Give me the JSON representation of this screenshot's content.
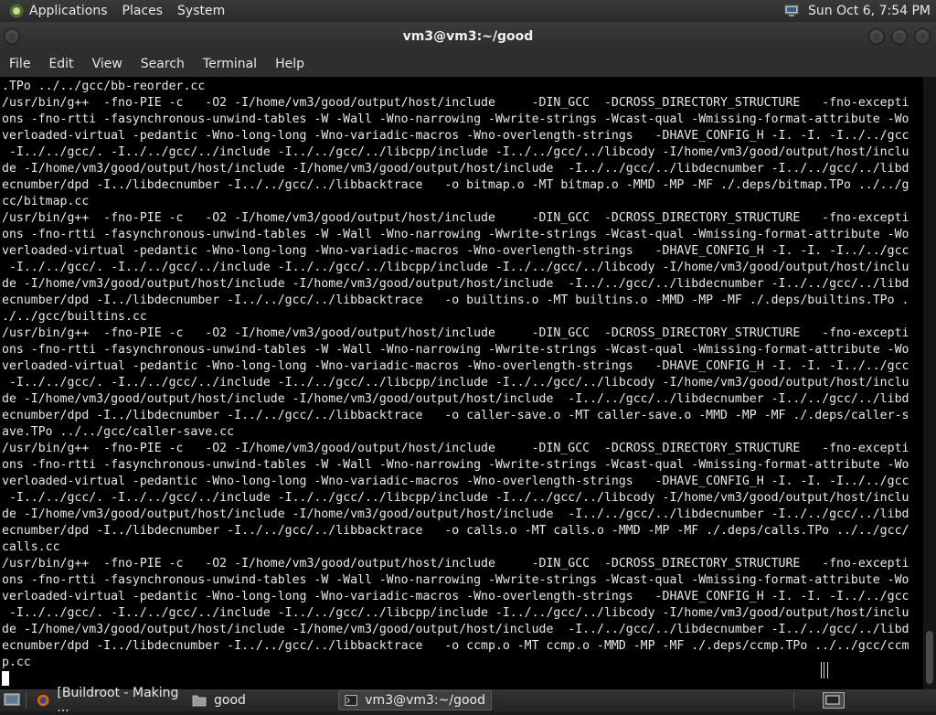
{
  "top_panel": {
    "menus": [
      "Applications",
      "Places",
      "System"
    ],
    "clock": "Sun Oct  6,  7:54 PM"
  },
  "window": {
    "title": "vm3@vm3:~/good",
    "menu": [
      "File",
      "Edit",
      "View",
      "Search",
      "Terminal",
      "Help"
    ]
  },
  "terminal": {
    "lines": [
      ".TPo ../../gcc/bb-reorder.cc",
      "/usr/bin/g++  -fno-PIE -c   -O2 -I/home/vm3/good/output/host/include     -DIN_GCC  -DCROSS_DIRECTORY_STRUCTURE   -fno-excepti",
      "ons -fno-rtti -fasynchronous-unwind-tables -W -Wall -Wno-narrowing -Wwrite-strings -Wcast-qual -Wmissing-format-attribute -Wo",
      "verloaded-virtual -pedantic -Wno-long-long -Wno-variadic-macros -Wno-overlength-strings   -DHAVE_CONFIG_H -I. -I. -I../../gcc",
      " -I../../gcc/. -I../../gcc/../include -I../../gcc/../libcpp/include -I../../gcc/../libcody -I/home/vm3/good/output/host/inclu",
      "de -I/home/vm3/good/output/host/include -I/home/vm3/good/output/host/include  -I../../gcc/../libdecnumber -I../../gcc/../libd",
      "ecnumber/dpd -I../libdecnumber -I../../gcc/../libbacktrace   -o bitmap.o -MT bitmap.o -MMD -MP -MF ./.deps/bitmap.TPo ../../g",
      "cc/bitmap.cc",
      "/usr/bin/g++  -fno-PIE -c   -O2 -I/home/vm3/good/output/host/include     -DIN_GCC  -DCROSS_DIRECTORY_STRUCTURE   -fno-excepti",
      "ons -fno-rtti -fasynchronous-unwind-tables -W -Wall -Wno-narrowing -Wwrite-strings -Wcast-qual -Wmissing-format-attribute -Wo",
      "verloaded-virtual -pedantic -Wno-long-long -Wno-variadic-macros -Wno-overlength-strings   -DHAVE_CONFIG_H -I. -I. -I../../gcc",
      " -I../../gcc/. -I../../gcc/../include -I../../gcc/../libcpp/include -I../../gcc/../libcody -I/home/vm3/good/output/host/inclu",
      "de -I/home/vm3/good/output/host/include -I/home/vm3/good/output/host/include  -I../../gcc/../libdecnumber -I../../gcc/../libd",
      "ecnumber/dpd -I../libdecnumber -I../../gcc/../libbacktrace   -o builtins.o -MT builtins.o -MMD -MP -MF ./.deps/builtins.TPo .",
      "./../gcc/builtins.cc",
      "/usr/bin/g++  -fno-PIE -c   -O2 -I/home/vm3/good/output/host/include     -DIN_GCC  -DCROSS_DIRECTORY_STRUCTURE   -fno-excepti",
      "ons -fno-rtti -fasynchronous-unwind-tables -W -Wall -Wno-narrowing -Wwrite-strings -Wcast-qual -Wmissing-format-attribute -Wo",
      "verloaded-virtual -pedantic -Wno-long-long -Wno-variadic-macros -Wno-overlength-strings   -DHAVE_CONFIG_H -I. -I. -I../../gcc",
      " -I../../gcc/. -I../../gcc/../include -I../../gcc/../libcpp/include -I../../gcc/../libcody -I/home/vm3/good/output/host/inclu",
      "de -I/home/vm3/good/output/host/include -I/home/vm3/good/output/host/include  -I../../gcc/../libdecnumber -I../../gcc/../libd",
      "ecnumber/dpd -I../libdecnumber -I../../gcc/../libbacktrace   -o caller-save.o -MT caller-save.o -MMD -MP -MF ./.deps/caller-s",
      "ave.TPo ../../gcc/caller-save.cc",
      "/usr/bin/g++  -fno-PIE -c   -O2 -I/home/vm3/good/output/host/include     -DIN_GCC  -DCROSS_DIRECTORY_STRUCTURE   -fno-excepti",
      "ons -fno-rtti -fasynchronous-unwind-tables -W -Wall -Wno-narrowing -Wwrite-strings -Wcast-qual -Wmissing-format-attribute -Wo",
      "verloaded-virtual -pedantic -Wno-long-long -Wno-variadic-macros -Wno-overlength-strings   -DHAVE_CONFIG_H -I. -I. -I../../gcc",
      " -I../../gcc/. -I../../gcc/../include -I../../gcc/../libcpp/include -I../../gcc/../libcody -I/home/vm3/good/output/host/inclu",
      "de -I/home/vm3/good/output/host/include -I/home/vm3/good/output/host/include  -I../../gcc/../libdecnumber -I../../gcc/../libd",
      "ecnumber/dpd -I../libdecnumber -I../../gcc/../libbacktrace   -o calls.o -MT calls.o -MMD -MP -MF ./.deps/calls.TPo ../../gcc/",
      "calls.cc",
      "/usr/bin/g++  -fno-PIE -c   -O2 -I/home/vm3/good/output/host/include     -DIN_GCC  -DCROSS_DIRECTORY_STRUCTURE   -fno-excepti",
      "ons -fno-rtti -fasynchronous-unwind-tables -W -Wall -Wno-narrowing -Wwrite-strings -Wcast-qual -Wmissing-format-attribute -Wo",
      "verloaded-virtual -pedantic -Wno-long-long -Wno-variadic-macros -Wno-overlength-strings   -DHAVE_CONFIG_H -I. -I. -I../../gcc",
      " -I../../gcc/. -I../../gcc/../include -I../../gcc/../libcpp/include -I../../gcc/../libcody -I/home/vm3/good/output/host/inclu",
      "de -I/home/vm3/good/output/host/include -I/home/vm3/good/output/host/include  -I../../gcc/../libdecnumber -I../../gcc/../libd",
      "ecnumber/dpd -I../libdecnumber -I../../gcc/../libbacktrace   -o ccmp.o -MT ccmp.o -MMD -MP -MF ./.deps/ccmp.TPo ../../gcc/ccm",
      "p.cc"
    ]
  },
  "taskbar": {
    "tasks": [
      "[Buildroot - Making ...",
      "good",
      "vm3@vm3:~/good"
    ]
  },
  "icons": {
    "distro_logo": "gnome-foot-icon",
    "network": "network-icon",
    "firefox": "firefox-icon",
    "folder": "folder-icon",
    "terminal": "terminal-icon"
  }
}
